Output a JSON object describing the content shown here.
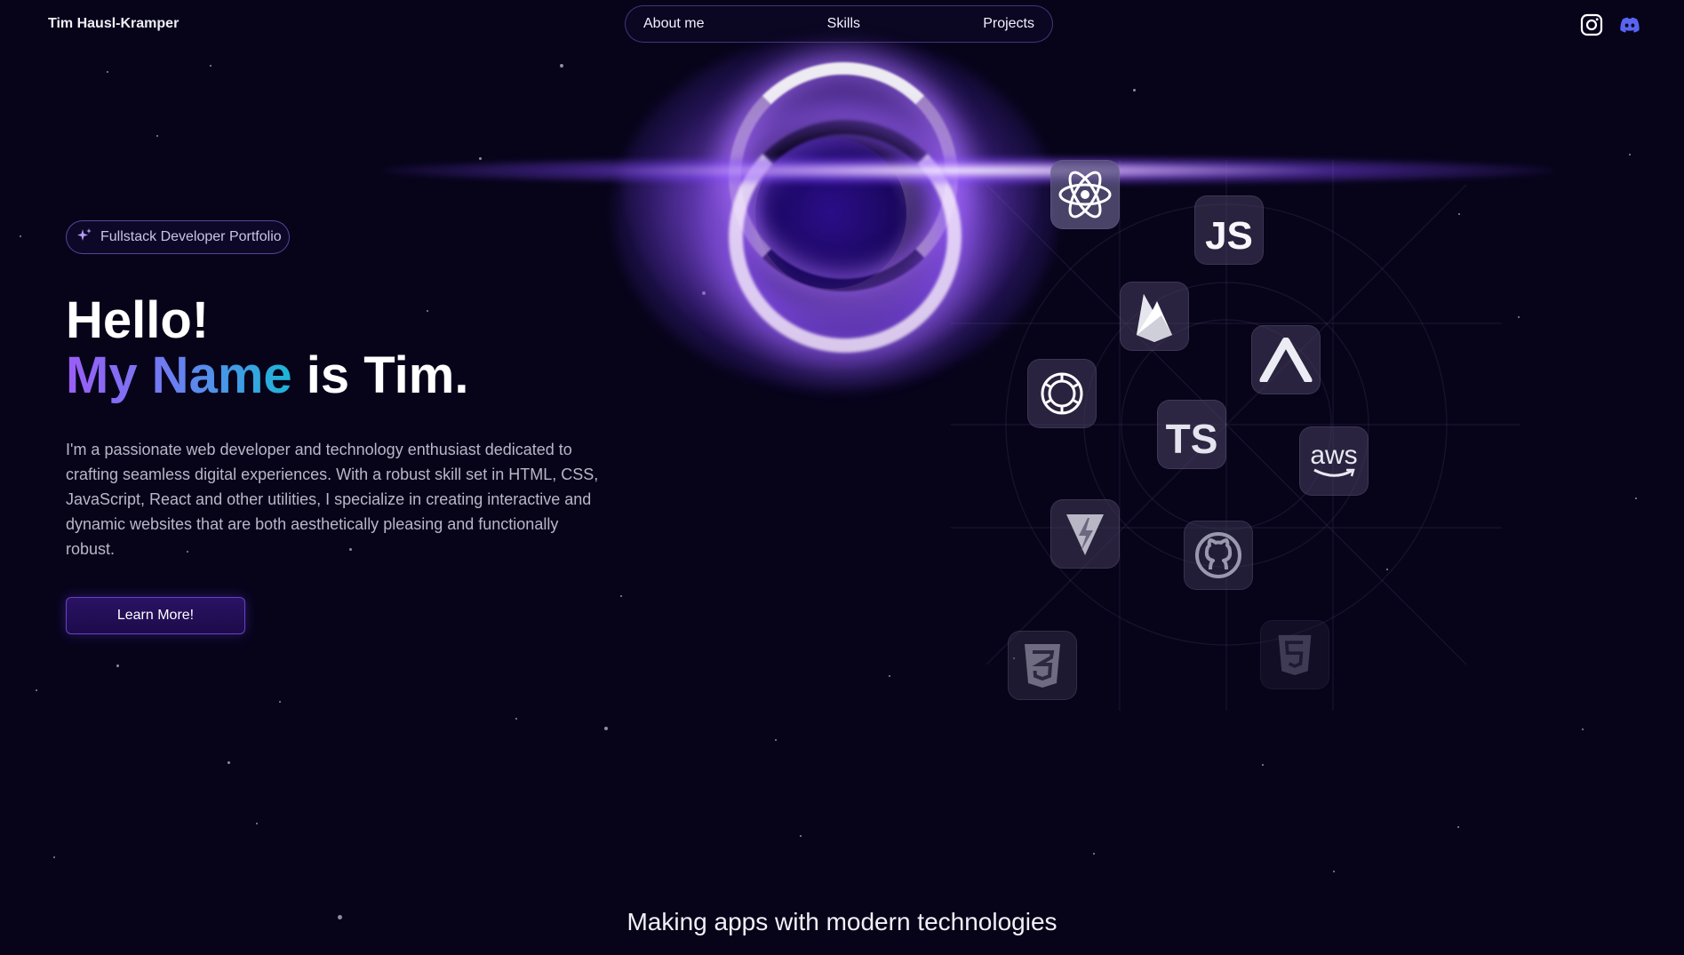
{
  "header": {
    "brand": "Tim Hausl-Kramper",
    "nav": [
      "About me",
      "Skills",
      "Projects"
    ],
    "social": [
      {
        "name": "instagram-icon",
        "color": "#ffffff"
      },
      {
        "name": "discord-icon",
        "color": "#5865F2"
      }
    ]
  },
  "hero": {
    "badge": "Fullstack Developer Portfolio",
    "greeting": "Hello!",
    "name_highlight": "My Name",
    "name_rest": "is Tim.",
    "bio": "I'm a passionate web developer and technology enthusiast dedicated to crafting seamless digital experiences. With a robust skill set in HTML, CSS, JavaScript, React and other utilities, I specialize in creating interactive and dynamic websites that are both aesthetically pleasing and functionally robust.",
    "cta": "Learn More!"
  },
  "skills": {
    "js_label": "JS",
    "ts_label": "TS",
    "aws_label": "aws",
    "icons": [
      "react-icon",
      "javascript-icon",
      "firebase-icon",
      "vercel-icon",
      "openai-icon",
      "typescript-icon",
      "aws-icon",
      "vite-icon",
      "github-icon",
      "css3-icon",
      "html5-icon"
    ]
  },
  "section_title": "Making apps with modern technologies",
  "colors": {
    "background": "#07041a",
    "accent_purple": "#9b5df5",
    "accent_cyan": "#1cb6d8"
  }
}
